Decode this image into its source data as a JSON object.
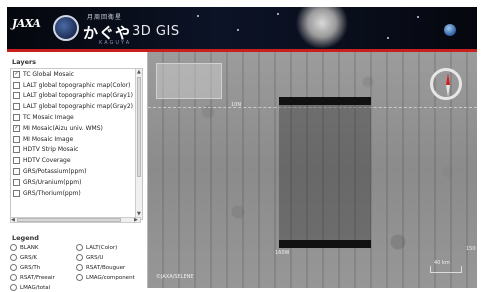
{
  "header": {
    "agency_logo_text": "JAXA",
    "app_title_kana": "かぐや",
    "app_title_suffix": "3D GIS",
    "emblem": "kaguya-emblem-icon",
    "earth": "earth-icon"
  },
  "layers": {
    "title": "Layers",
    "items": [
      {
        "label": "TC Global Mosaic",
        "checked": true
      },
      {
        "label": "LALT global topographic map(Color)",
        "checked": false
      },
      {
        "label": "LALT global topographic map(Gray1)",
        "checked": false
      },
      {
        "label": "LALT global topographic map(Gray2)",
        "checked": false
      },
      {
        "label": "TC Mosaic Image",
        "checked": false
      },
      {
        "label": "MI Mosaic(Aizu univ. WMS)",
        "checked": true
      },
      {
        "label": "MI Mosaic Image",
        "checked": false
      },
      {
        "label": "HDTV Strip Mosaic",
        "checked": false
      },
      {
        "label": "HDTV Coverage",
        "checked": false
      },
      {
        "label": "GRS/Potassium(ppm)",
        "checked": false
      },
      {
        "label": "GRS/Uranium(ppm)",
        "checked": false
      },
      {
        "label": "GRS/Thorium(ppm)",
        "checked": false
      }
    ]
  },
  "legend": {
    "title": "Legend",
    "options": [
      "BLANK",
      "LALT(Color)",
      "GRS/K",
      "GRS/U",
      "GRS/Th",
      "RSAT/Bouguer",
      "RSAT/Freeair",
      "LMAG/component",
      "LMAG/total"
    ]
  },
  "map": {
    "labels": {
      "lat_left": "10N",
      "lon_bottom": "160W",
      "lon_right": "150",
      "copyright": "©JAXA/SELENE",
      "scale": "40 km"
    }
  },
  "colors": {
    "accent_red": "#c8201e",
    "header_bg": "#0a0f1e"
  }
}
